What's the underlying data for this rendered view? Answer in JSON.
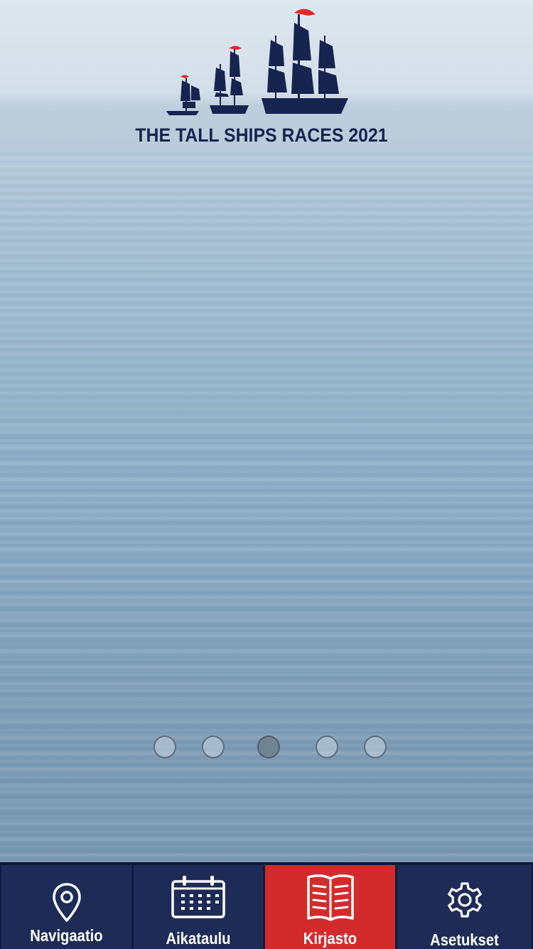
{
  "logo": {
    "text": "THE TALL SHIPS RACES 2021",
    "brand_color": "#17244f",
    "flag_color": "#e4262a"
  },
  "carousel": {
    "dots": 5,
    "active_index": 2
  },
  "bottom_nav": {
    "items": [
      {
        "label": "Navigaatio",
        "icon": "map-pin-icon"
      },
      {
        "label": "Aikataulu",
        "icon": "calendar-icon"
      },
      {
        "label": "Kirjasto",
        "icon": "book-icon"
      },
      {
        "label": "Asetukset",
        "icon": "gear-icon"
      }
    ],
    "active_index": 2,
    "active_color": "#d32b2b",
    "bg_color": "#1d2b56"
  }
}
